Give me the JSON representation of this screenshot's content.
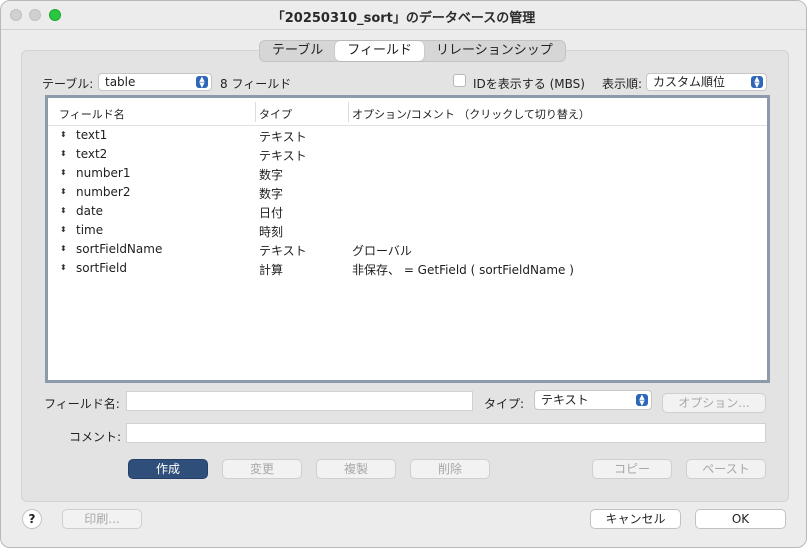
{
  "window": {
    "title": "「20250310_sort」のデータベースの管理"
  },
  "tabs": [
    {
      "label": "テーブル",
      "active": false
    },
    {
      "label": "フィールド",
      "active": true
    },
    {
      "label": "リレーションシップ",
      "active": false
    }
  ],
  "toolbar": {
    "table_label": "テーブル:",
    "table_value": "table",
    "field_count": "8 フィールド",
    "show_id_label": "IDを表示する (MBS)",
    "show_id_checked": false,
    "order_label": "表示順:",
    "order_value": "カスタム順位"
  },
  "table": {
    "headers": [
      "フィールド名",
      "タイプ",
      "オプション/コメント （クリックして切り替え）"
    ],
    "rows": [
      {
        "name": "text1",
        "type": "テキスト",
        "options": ""
      },
      {
        "name": "text2",
        "type": "テキスト",
        "options": ""
      },
      {
        "name": "number1",
        "type": "数字",
        "options": ""
      },
      {
        "name": "number2",
        "type": "数字",
        "options": ""
      },
      {
        "name": "date",
        "type": "日付",
        "options": ""
      },
      {
        "name": "time",
        "type": "時刻",
        "options": ""
      },
      {
        "name": "sortFieldName",
        "type": "テキスト",
        "options": "グローバル"
      },
      {
        "name": "sortField",
        "type": "計算",
        "options": "非保存、 = GetField ( sortFieldName )"
      }
    ]
  },
  "form": {
    "field_name_label": "フィールド名:",
    "field_name_value": "",
    "type_label": "タイプ:",
    "type_value": "テキスト",
    "options_button": "オプション...",
    "comment_label": "コメント:",
    "comment_value": ""
  },
  "actions": {
    "create": "作成",
    "change": "変更",
    "duplicate": "複製",
    "delete": "削除",
    "copy": "コピー",
    "paste": "ペースト"
  },
  "footer": {
    "help": "?",
    "print": "印刷...",
    "cancel": "キャンセル",
    "ok": "OK"
  },
  "colors": {
    "primary_button": "#2f4f7a",
    "traffic_zoom": "#2ac840",
    "table_border": "#8c9bab"
  }
}
